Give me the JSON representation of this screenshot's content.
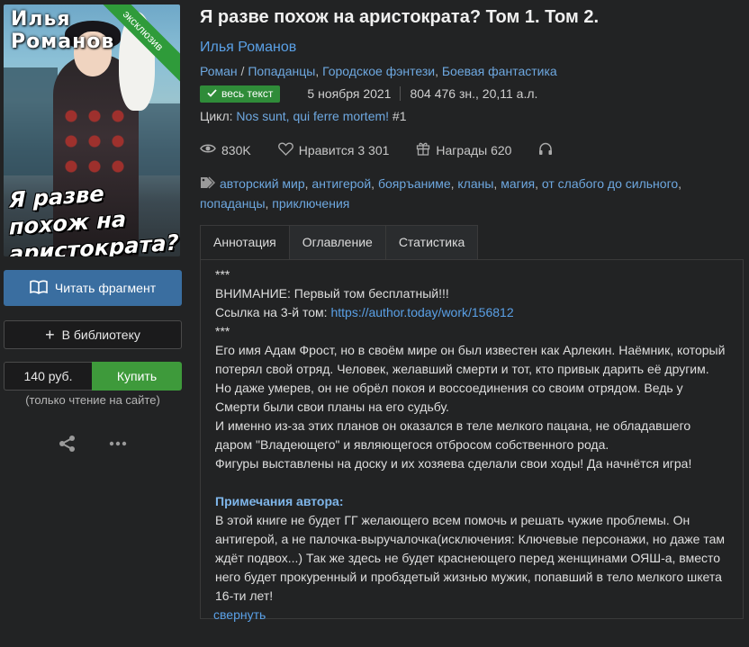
{
  "cover": {
    "author_text": "Илья Романов",
    "title_text": "Я разве похож на аристократа?",
    "ribbon": "эксклюзив"
  },
  "actions": {
    "read_fragment": "Читать фрагмент",
    "to_library": "В библиотеку",
    "price": "140 руб.",
    "buy": "Купить",
    "buy_note": "(только чтение на сайте)"
  },
  "book": {
    "title": "Я разве похож на аристократа? Том 1. Том 2.",
    "author": "Илья Романов",
    "genres": [
      "Роман",
      "Попаданцы",
      "Городское фэнтези",
      "Боевая фантастика"
    ],
    "genre_prefix_sep": " / ",
    "status_badge": "весь текст",
    "date": "5 ноября 2021",
    "size": "804 476 зн., 20,11 а.л.",
    "cycle_label": "Цикл: ",
    "cycle_name": "Nos sunt, qui ferre mortem!",
    "cycle_num": " #1"
  },
  "stats": {
    "views": "830K",
    "likes": "Нравится 3 301",
    "awards": "Награды 620"
  },
  "tags": [
    "авторский мир",
    "антигерой",
    "бояръаниме",
    "кланы",
    "магия",
    "от слабого до сильного",
    "попаданцы",
    "приключения"
  ],
  "tabs": [
    "Аннотация",
    "Оглавление",
    "Статистика"
  ],
  "annotation": {
    "line1": "***",
    "line2": "ВНИМАНИЕ: Первый том бесплатный!!!",
    "line3_prefix": "Ссылка на 3-й том: ",
    "line3_link": "https://author.today/work/156812",
    "line4": "***",
    "para1": "Его имя Адам Фрост, но в своём мире он был известен как Арлекин. Наёмник, который потерял свой отряд. Человек, желавший смерти и тот, кто привык дарить её другим. Но даже умерев, он не обрёл покоя и воссоединения со своим отрядом. Ведь у Смерти были свои планы на его судьбу.",
    "para2": "И именно из-за этих планов он оказался в теле мелкого пацана, не обладавшего даром \"Владеющего\" и являющегося отбросом собственного рода.",
    "para3": "Фигуры выставлены на доску и их хозяева сделали свои ходы! Да начнётся игра!",
    "notes_head": "Примечания автора:",
    "notes": "В этой книге не будет ГГ желающего всем помочь и решать чужие проблемы. Он антигерой, а не палочка-выручалочка(исключения: Ключевые персонажи, но даже там ждёт подвох...) Так же здесь не будет краснеющего перед женщинами ОЯШ-а, вместо него будет прокуренный и пробздетый жизнью мужик, попавший в тело мелкого шкета 16-ти лет!",
    "collapse": "свернуть"
  }
}
